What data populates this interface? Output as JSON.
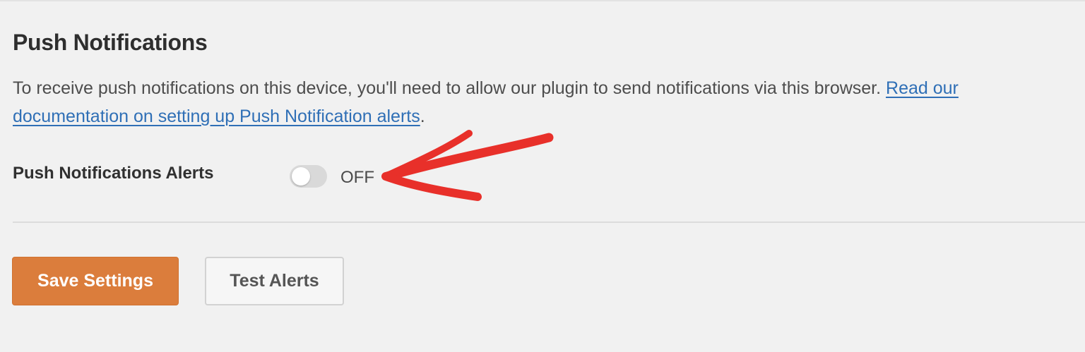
{
  "section": {
    "title": "Push Notifications",
    "description": "To receive push notifications on this device, you'll need to allow our plugin to send notifications via this browser. ",
    "doc_link": "Read our documentation on setting up Push Notification alerts",
    "description_end": "."
  },
  "alerts": {
    "label": "Push Notifications Alerts",
    "state": "OFF",
    "enabled": false
  },
  "actions": {
    "save_label": "Save Settings",
    "test_label": "Test Alerts"
  },
  "colors": {
    "background": "#f1f1f1",
    "link": "#2f6fb6",
    "primary_button": "#db7d3c",
    "annotation_arrow": "#e8302a"
  }
}
